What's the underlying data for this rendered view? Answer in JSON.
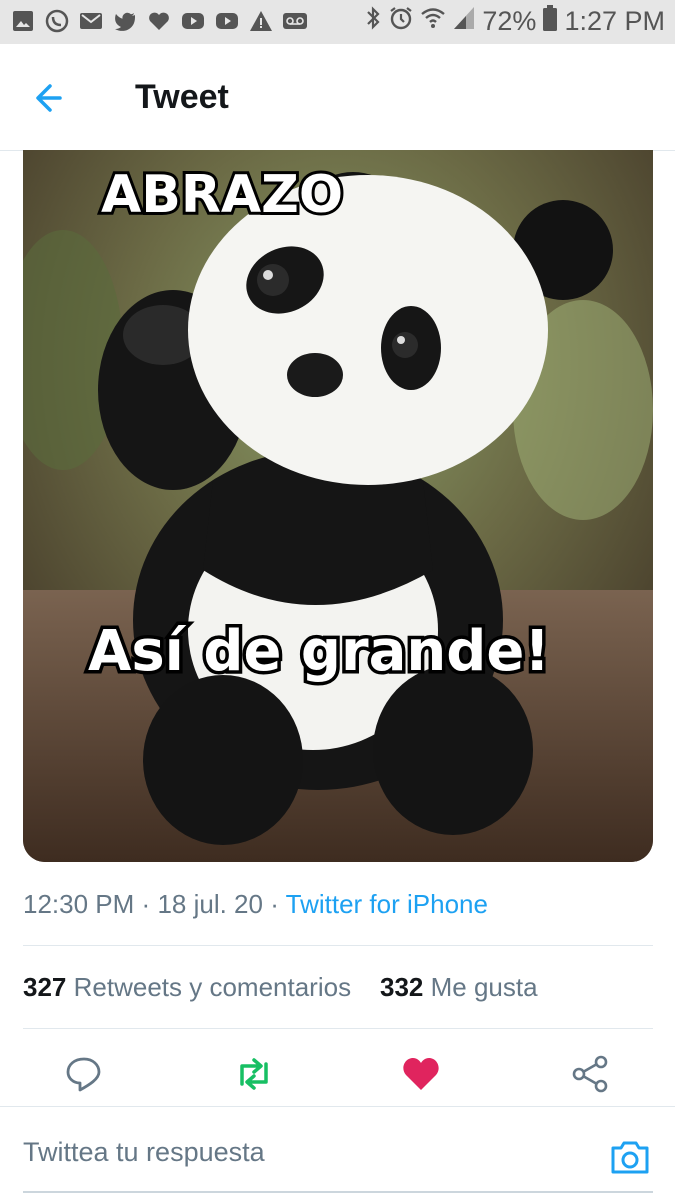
{
  "status_bar": {
    "left_icons": [
      "gallery-icon",
      "whatsapp-icon",
      "gmail-icon",
      "twitter-icon",
      "heart-icon",
      "youtube-icon",
      "youtube-icon",
      "warning-icon",
      "voicemail-icon"
    ],
    "battery": "72%",
    "time": "1:27 PM"
  },
  "header": {
    "title": "Tweet"
  },
  "media": {
    "top_text": "ABRAZO",
    "bottom_text": "Así de grande!"
  },
  "tweet_meta": {
    "time": "12:30 PM",
    "sep1": "·",
    "date": "18 jul. 20",
    "sep2": "·",
    "source": "Twitter for iPhone"
  },
  "stats": {
    "retweets_count": "327",
    "retweets_label": "Retweets y comentarios",
    "likes_count": "332",
    "likes_label": "Me gusta"
  },
  "reply": {
    "placeholder": "Twittea tu respuesta"
  },
  "colors": {
    "accent": "#1da1f2",
    "retweet": "#17bf63",
    "like": "#e0245e",
    "text": "#14171a",
    "muted": "#657786"
  }
}
